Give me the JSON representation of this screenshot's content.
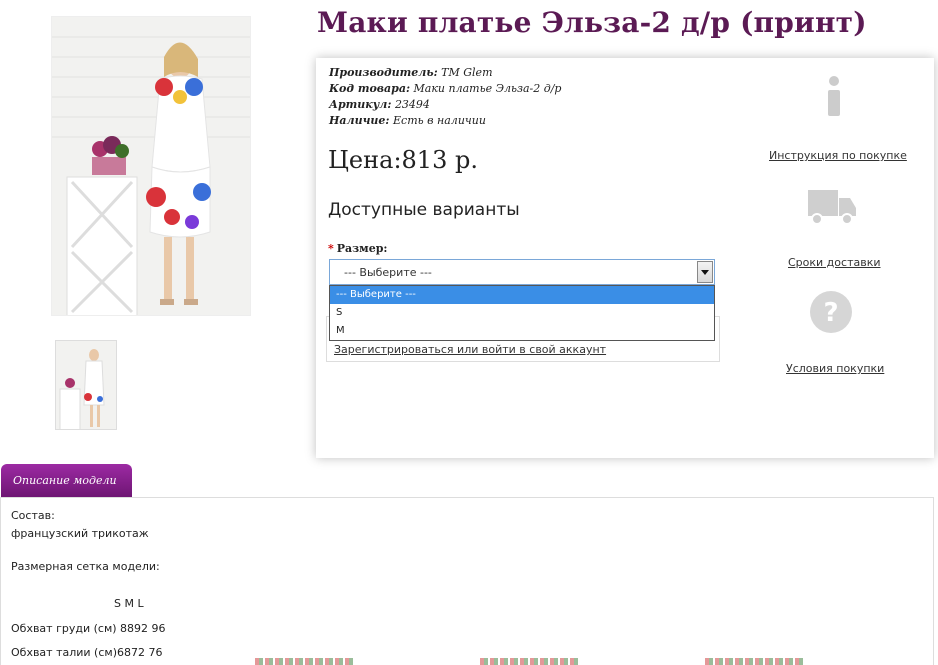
{
  "product": {
    "title": "Маки платье Эльза-2 д/р (принт)",
    "manufacturer_label": "Производитель:",
    "manufacturer": "TM Glem",
    "code_label": "Код товара:",
    "code": "Маки платье Эльза-2 д/р",
    "sku_label": "Артикул:",
    "sku": "23494",
    "stock_label": "Наличие:",
    "stock": "Есть в наличии",
    "price": "Цена:813 р.",
    "variants_title": "Доступные варианты",
    "size_label": "Размер:",
    "size_required_mark": "*",
    "size_selected": "--- Выберите ---",
    "size_options": [
      "--- Выберите ---",
      "S",
      "M"
    ],
    "account_link": "Зарегистрироваться или войти в свой аккаунт"
  },
  "side_info": {
    "instruction_link": "Инструкция по покупке",
    "delivery_link": "Сроки доставки",
    "terms_link": "Условия покупки"
  },
  "description": {
    "tab_label": "Описание модели",
    "composition_label": "Состав:",
    "composition": "французский трикотаж",
    "size_grid_label": "Размерная сетка модели:",
    "size_grid_header": "S  M  L",
    "chest_row": "Обхват груди (см) 8892 96",
    "waist_row": "Обхват талии (см)6872 76"
  },
  "colors": {
    "title": "#5b1a54",
    "tab": "#8a1f90",
    "selected_option": "#3a8ee6"
  }
}
